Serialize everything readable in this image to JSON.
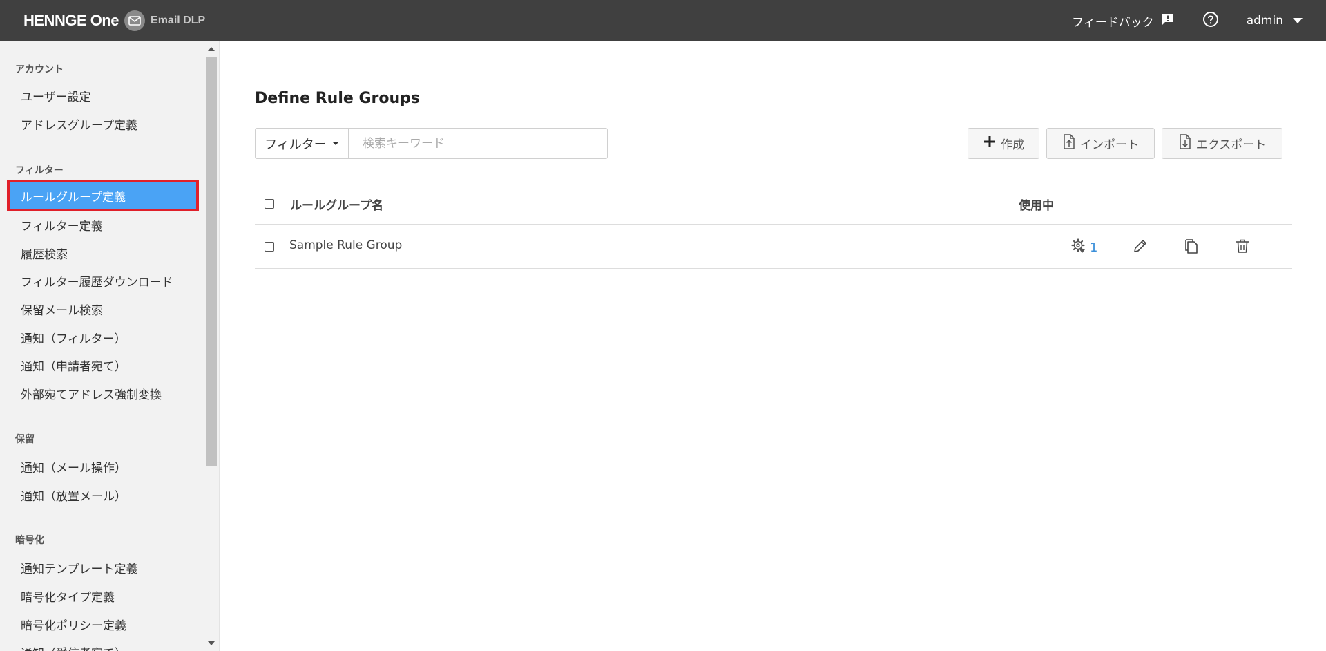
{
  "header": {
    "brand_logo": "HENNGE One",
    "product": "Email DLP",
    "feedback_label": "フィードバック",
    "user": "admin"
  },
  "sidebar": {
    "sections": [
      {
        "title": "アカウント",
        "items": [
          "ユーザー設定",
          "アドレスグループ定義"
        ]
      },
      {
        "title": "フィルター",
        "items": [
          "ルールグループ定義",
          "フィルター定義",
          "履歴検索",
          "フィルター履歴ダウンロード",
          "保留メール検索",
          "通知（フィルター）",
          "通知（申請者宛て）",
          "外部宛てアドレス強制変換"
        ]
      },
      {
        "title": "保留",
        "items": [
          "通知（メール操作）",
          "通知（放置メール）"
        ]
      },
      {
        "title": "暗号化",
        "items": [
          "通知テンプレート定義",
          "暗号化タイプ定義",
          "暗号化ポリシー定義",
          "通知（受信者宛て）"
        ]
      }
    ],
    "active_item": "ルールグループ定義"
  },
  "main": {
    "title": "Define Rule Groups",
    "filter_label": "フィルター",
    "search_placeholder": "検索キーワード",
    "search_value": "",
    "create_label": "作成",
    "import_label": "インポート",
    "export_label": "エクスポート",
    "table": {
      "columns": [
        "ルールグループ名",
        "使用中"
      ],
      "rows": [
        {
          "name": "Sample Rule Group",
          "in_use": "1"
        }
      ]
    }
  },
  "colors": {
    "topbar": "#404040",
    "sidebar_bg": "#f2f2f2",
    "active_bg": "#4aa3f5",
    "active_outline": "#e0202a",
    "link": "#3b8fd9"
  }
}
